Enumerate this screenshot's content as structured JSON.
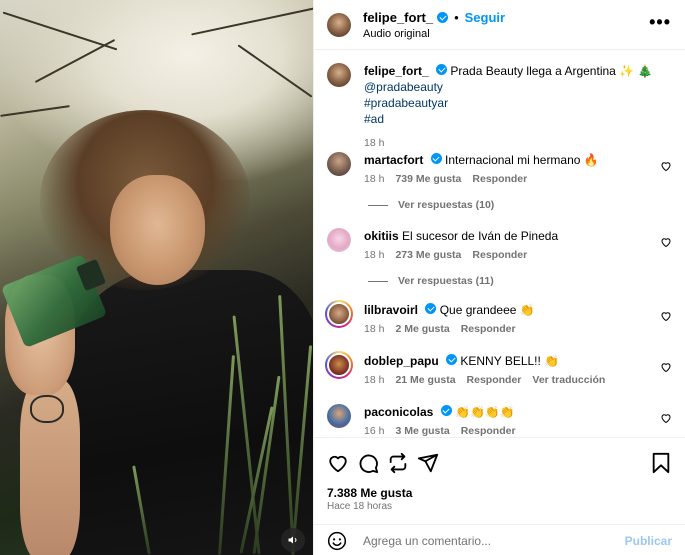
{
  "colors": {
    "accent": "#0095f6",
    "meta_gray": "#737373",
    "hashtag": "#00376b",
    "publish_disabled": "#9cc8f0"
  },
  "header": {
    "username": "felipe_fort_",
    "separator": "•",
    "follow_label": "Seguir",
    "audio": "Audio original",
    "more_label": "•••"
  },
  "caption": {
    "username": "felipe_fort_",
    "text": "Prada Beauty llega a Argentina",
    "emojis": "✨ 🎄",
    "mention": "@pradabeauty",
    "hashtag1": "#pradabeautyar",
    "hashtag2": "#ad",
    "time": "18 h"
  },
  "comments": [
    {
      "username": "martacfort",
      "verified": true,
      "text": "Internacional mi hermano",
      "emoji": "🔥",
      "time": "18 h",
      "likes": "739 Me gusta",
      "reply": "Responder",
      "view_replies": "Ver respuestas (10)"
    },
    {
      "username": "okitiis",
      "verified": false,
      "text": "El sucesor de Iván de Pineda",
      "emoji": "",
      "time": "18 h",
      "likes": "273 Me gusta",
      "reply": "Responder",
      "view_replies": "Ver respuestas (11)"
    },
    {
      "username": "lilbravoirl",
      "verified": true,
      "text": "Que grandeee",
      "emoji": "👏",
      "time": "18 h",
      "likes": "2 Me gusta",
      "reply": "Responder"
    },
    {
      "username": "doblep_papu",
      "verified": true,
      "text": "KENNY BELL!!",
      "emoji": "👏",
      "time": "18 h",
      "likes": "21 Me gusta",
      "reply": "Responder",
      "translate": "Ver traducción"
    },
    {
      "username": "paconicolas",
      "verified": true,
      "text": "",
      "emoji": "👏👏👏👏",
      "time": "16 h",
      "likes": "3 Me gusta",
      "reply": "Responder"
    }
  ],
  "footer": {
    "likes": "7.388 Me gusta",
    "posted": "Hace 18 horas",
    "comment_placeholder": "Agrega un comentario...",
    "publish_label": "Publicar"
  },
  "icons": [
    "heart-icon",
    "comment-icon",
    "repost-icon",
    "share-icon",
    "bookmark-icon",
    "emoji-icon",
    "mute-icon",
    "more-icon"
  ]
}
